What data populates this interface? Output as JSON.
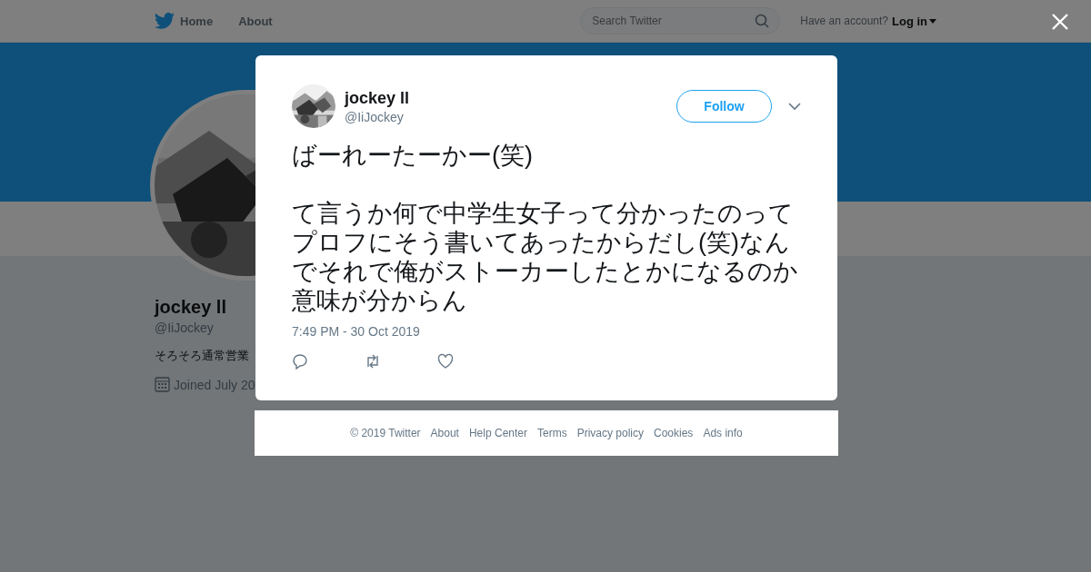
{
  "nav": {
    "items": [
      {
        "label": "Home"
      },
      {
        "label": "About"
      }
    ],
    "search": {
      "placeholder": "Search Twitter"
    },
    "account_prompt": "Have an account?",
    "login": "Log in"
  },
  "profile": {
    "name": "jockey ll",
    "handle": "@IiJockey",
    "bio": "そろそろ通常営業",
    "joined": "Joined July 20"
  },
  "tweet": {
    "name": "jockey ll",
    "handle": "@IiJockey",
    "follow": "Follow",
    "text": "ばーれーたーかー(笑)\n\nて言うか何で中学生女子って分かったのってプロフにそう書いてあったからだし(笑)なんでそれで俺がストーカーしたとかになるのか意味が分からん",
    "time": "7:49 PM - 30 Oct 2019"
  },
  "footer": {
    "links": [
      "© 2019 Twitter",
      "About",
      "Help Center",
      "Terms",
      "Privacy policy",
      "Cookies",
      "Ads info"
    ]
  }
}
